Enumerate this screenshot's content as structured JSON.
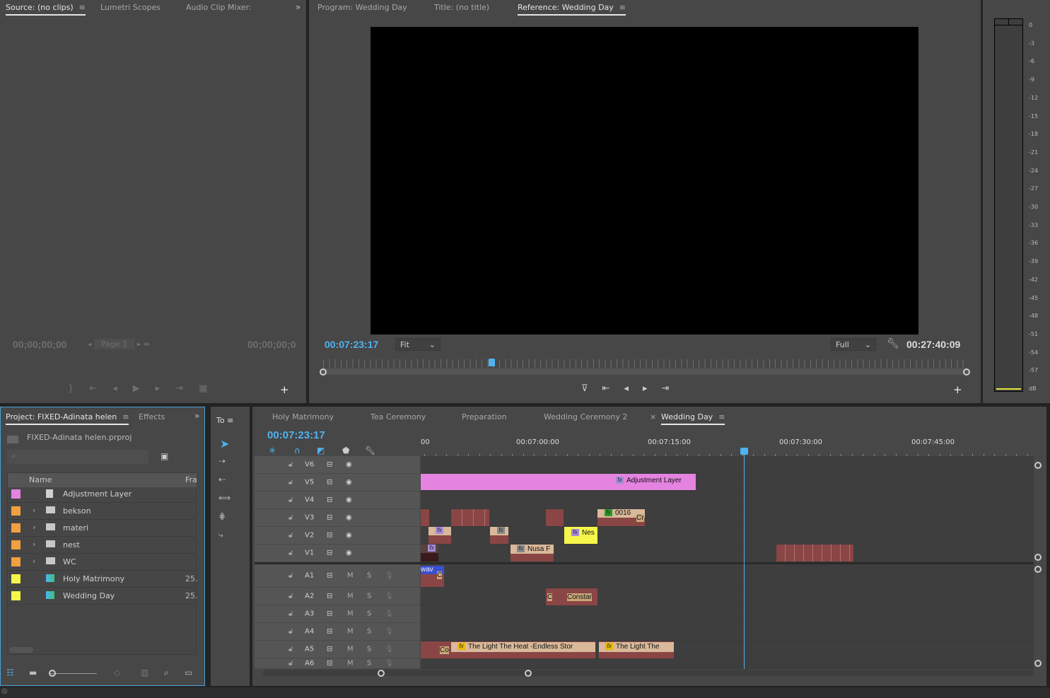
{
  "source_panel": {
    "tabs": [
      "Source: (no clips)",
      "Lumetri Scopes",
      "Audio Clip Mixer:"
    ],
    "timecode_left": "00;00;00;00",
    "timecode_right": "00;00;00;0",
    "page": "Page 1"
  },
  "program_panel": {
    "tabs": [
      "Program: Wedding Day",
      "Title: (no title)",
      "Reference: Wedding Day"
    ],
    "timecode": "00:07:23:17",
    "zoom": "Fit",
    "quality": "Full",
    "duration": "00:27:40:09",
    "playhead_fraction": 0.264
  },
  "meter": {
    "labels": [
      "0",
      "-3",
      "-6",
      "-9",
      "-12",
      "-15",
      "-18",
      "-21",
      "-24",
      "-27",
      "-30",
      "-33",
      "-36",
      "-39",
      "-42",
      "-45",
      "-48",
      "-51",
      "-54",
      "-57",
      "dB"
    ]
  },
  "project_panel": {
    "tabs": [
      "Project: FIXED-Adinata helen",
      "Effects"
    ],
    "file": "FIXED-Adinata helen.prproj",
    "search_placeholder": "",
    "columns": [
      "Name",
      "Fra"
    ],
    "items": [
      {
        "name": "Adjustment Layer",
        "color": "#e484e0",
        "type": "adjustment",
        "fr": ""
      },
      {
        "name": "bekson",
        "color": "#f0a040",
        "type": "folder",
        "fr": ""
      },
      {
        "name": "materi",
        "color": "#f0a040",
        "type": "folder",
        "fr": ""
      },
      {
        "name": "nest",
        "color": "#f0a040",
        "type": "folder",
        "fr": ""
      },
      {
        "name": "WC",
        "color": "#f0a040",
        "type": "folder",
        "fr": ""
      },
      {
        "name": "Holy Matrimony",
        "color": "#f5f54a",
        "type": "sequence",
        "fr": "25."
      },
      {
        "name": "Wedding Day",
        "color": "#f5f54a",
        "type": "sequence",
        "fr": "25."
      }
    ]
  },
  "tools_panel": {
    "title": "To"
  },
  "timeline": {
    "tabs": [
      "Holy Matrimony",
      "Tea Ceremony",
      "Preparation",
      "Wedding Ceremony 2",
      "Wedding Day"
    ],
    "active_tab": "Wedding Day",
    "timecode": "00:07:23:17",
    "ruler": [
      "00",
      "00:07:00:00",
      "00:07:15:00",
      "00:07:30:00",
      "00:07:45:00"
    ],
    "video_tracks": [
      "V6",
      "V5",
      "V4",
      "V3",
      "V2",
      "V1"
    ],
    "audio_tracks": [
      "A1",
      "A2",
      "A3",
      "A4",
      "A5",
      "A6"
    ],
    "mute": "M",
    "solo": "S",
    "clips": {
      "adjustment": "Adjustment Layer",
      "c0016": "0016",
      "cr": "Cr",
      "nes": "Nes",
      "nusa": "Nusa F",
      "wav": "wav",
      "c": "C",
      "constar": "Constar",
      "co": "Co",
      "light1": "The Light The Heat -Endless Stor",
      "light2": "The Light The",
      "fx": "fx"
    }
  },
  "colors": {
    "accent": "#4fb3f0",
    "adjustment": "#e484e0",
    "clip_red": "#8a4545",
    "clip_tan": "#d9b99a",
    "nest_yellow": "#f5f54a"
  }
}
